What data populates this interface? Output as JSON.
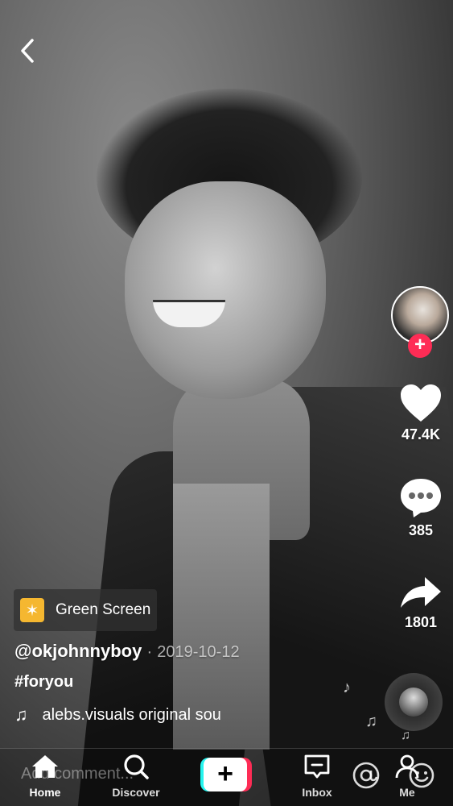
{
  "video": {
    "effect_label": "Green Screen",
    "username": "@okjohnnyboy",
    "date_separator": "·",
    "date": "2019-10-12",
    "caption": "#foryou",
    "sound": "alebs.visuals   original sou"
  },
  "rail": {
    "likes": "47.4K",
    "comments": "385",
    "shares": "1801"
  },
  "comment_input": {
    "placeholder": "Add comment..."
  },
  "bottom_nav": {
    "items": [
      {
        "label": "Home",
        "icon": "home-icon"
      },
      {
        "label": "Discover",
        "icon": "search-icon"
      },
      {
        "label": "",
        "icon": "create-plus-icon"
      },
      {
        "label": "Inbox",
        "icon": "inbox-icon"
      },
      {
        "label": "Me",
        "icon": "profile-icon"
      }
    ]
  },
  "colors": {
    "accent_red": "#fe2c55",
    "accent_cyan": "#25f4ee",
    "effect_yellow": "#f5b730"
  }
}
